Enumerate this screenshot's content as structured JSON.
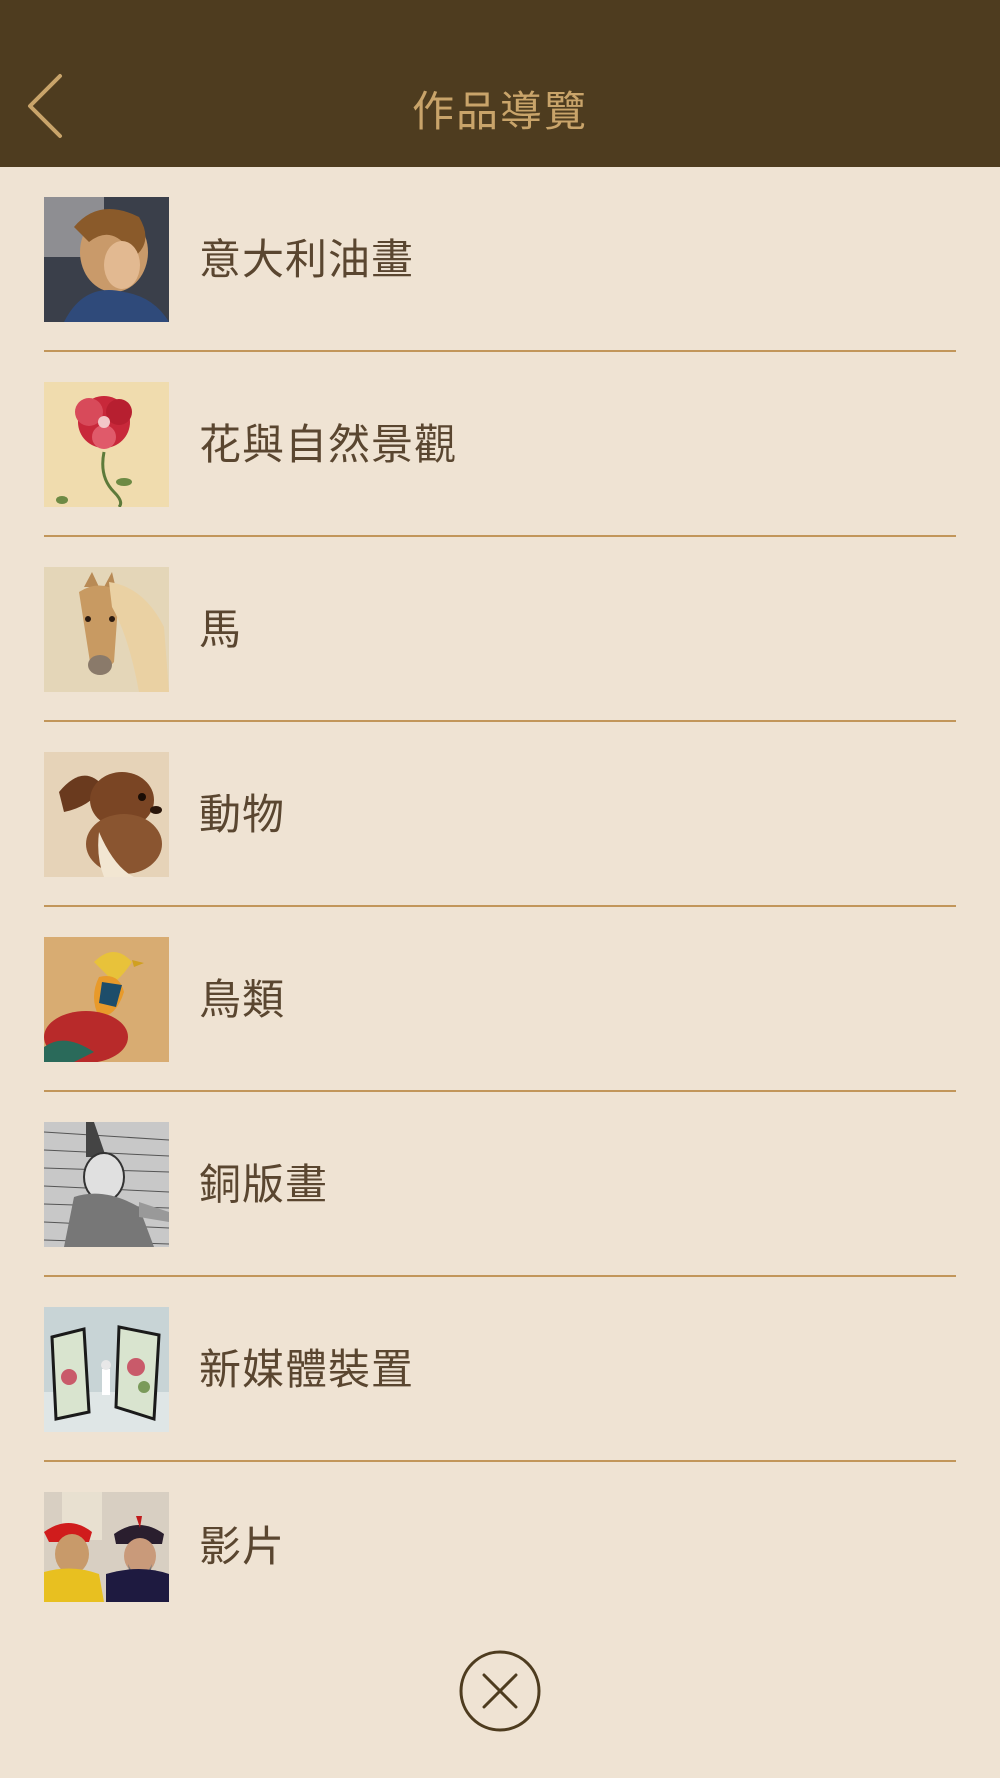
{
  "header": {
    "title": "作品導覽",
    "back_icon": "chevron-left-icon"
  },
  "categories": [
    {
      "label": "意大利油畫",
      "thumb": "italian-oil-painting-thumbnail"
    },
    {
      "label": "花與自然景觀",
      "thumb": "flower-nature-thumbnail"
    },
    {
      "label": "馬",
      "thumb": "horse-thumbnail"
    },
    {
      "label": "動物",
      "thumb": "animal-thumbnail"
    },
    {
      "label": "鳥類",
      "thumb": "bird-thumbnail"
    },
    {
      "label": "銅版畫",
      "thumb": "copperplate-engraving-thumbnail"
    },
    {
      "label": "新媒體裝置",
      "thumb": "new-media-installation-thumbnail"
    },
    {
      "label": "影片",
      "thumb": "video-thumbnail"
    }
  ],
  "close_icon": "close-circle-icon",
  "colors": {
    "header_bg": "#4e3c1f",
    "page_bg": "#efe3d3",
    "accent": "#c9a46a",
    "divider": "#c2965a",
    "text": "#5a4630"
  }
}
